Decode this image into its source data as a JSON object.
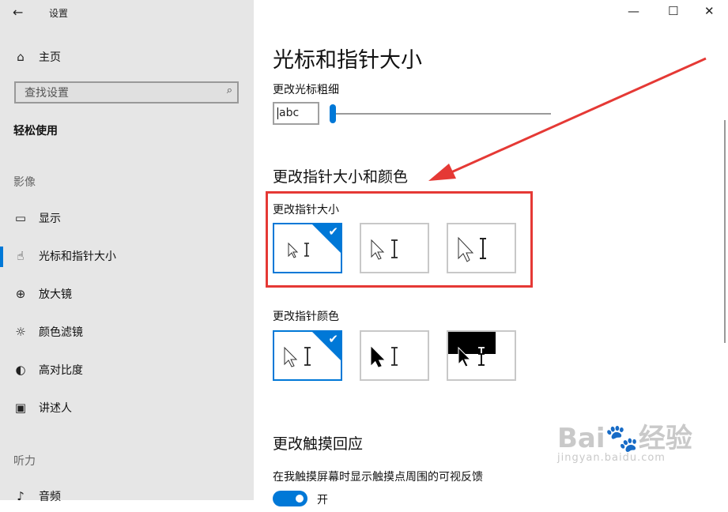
{
  "app": {
    "title": "设置",
    "back_icon": "←"
  },
  "window": {
    "minimize": "—",
    "maximize": "☐",
    "close": "✕"
  },
  "sidebar": {
    "home": {
      "label": "主页",
      "icon": "⌂"
    },
    "search": {
      "placeholder": "查找设置",
      "icon": "⌕"
    },
    "group_title": "轻松使用",
    "section_vision": "影像",
    "items": [
      {
        "label": "显示",
        "icon": "▭"
      },
      {
        "label": "光标和指针大小",
        "icon": "☝"
      },
      {
        "label": "放大镜",
        "icon": "⊕"
      },
      {
        "label": "颜色滤镜",
        "icon": "☼"
      },
      {
        "label": "高对比度",
        "icon": "◐"
      },
      {
        "label": "讲述人",
        "icon": "▣"
      }
    ],
    "section_hearing": "听力",
    "audio": {
      "label": "音频",
      "icon": "♪"
    }
  },
  "main": {
    "title": "光标和指针大小",
    "cursor_thickness": {
      "label": "更改光标粗细",
      "preview_text": "abc",
      "slider_value": 1
    },
    "pointer_section_title": "更改指针大小和颜色",
    "pointer_size": {
      "label": "更改指针大小",
      "selected_index": 0,
      "options": 3
    },
    "pointer_color": {
      "label": "更改指针颜色",
      "selected_index": 0,
      "options": 3
    },
    "touch_section_title": "更改触摸回应",
    "touch_feedback": {
      "label": "在我触摸屏幕时显示触摸点周围的可视反馈",
      "toggle_text": "开",
      "on": true
    },
    "check_icon": "✔"
  },
  "overlay": {
    "arrow_color": "#e53935",
    "highlight_color": "#e53935",
    "watermark_logo": "Bai🐾经验",
    "watermark_url": "jingyan.baidu.com"
  },
  "colors": {
    "accent": "#0078d7",
    "sidebar_bg": "#e6e6e6"
  }
}
